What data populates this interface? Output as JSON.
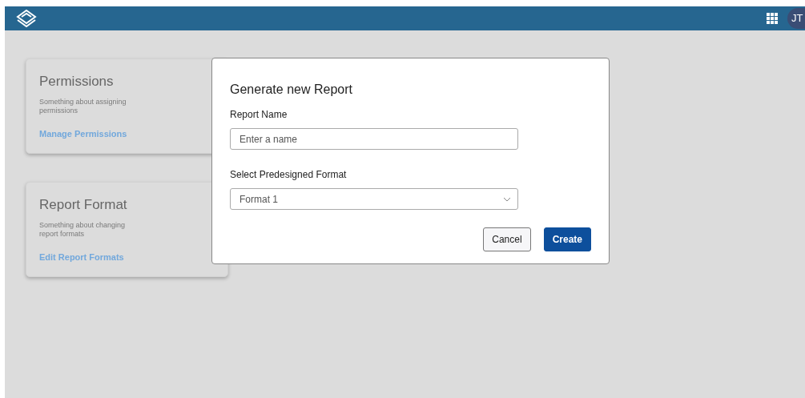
{
  "header": {
    "avatar": "JT"
  },
  "cards": [
    {
      "title": "Permissions",
      "description": "Something about assigning permissions",
      "link": "Manage Permissions"
    },
    {
      "title": "Report Format",
      "description": "Something about changing report formats",
      "link": "Edit Report Formats"
    }
  ],
  "dialog": {
    "title": "Generate new Report",
    "name_label": "Report Name",
    "name_placeholder": "Enter a name",
    "format_label": "Select Predesigned Format",
    "format_value": "Format 1",
    "buttons": [
      {
        "label": "Cancel",
        "kind": "secondary"
      },
      {
        "label": "Create",
        "kind": "primary"
      }
    ]
  }
}
